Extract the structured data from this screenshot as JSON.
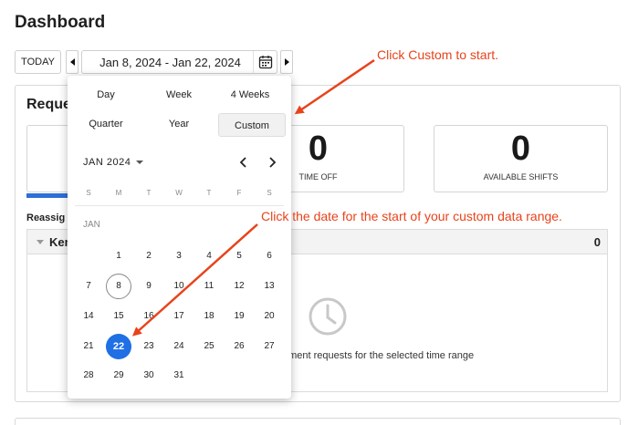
{
  "header": {
    "title": "Dashboard"
  },
  "toolbar": {
    "today_label": "TODAY",
    "date_range": "Jan 8, 2024 - Jan 22, 2024"
  },
  "requests": {
    "title": "Reque",
    "stats": [
      {
        "value": "",
        "label": ""
      },
      {
        "value": "0",
        "label": "TIME OFF"
      },
      {
        "value": "0",
        "label": "AVAILABLE SHIFTS"
      }
    ],
    "reassign_label": "Reassig",
    "group": {
      "name": "Ker",
      "count": "0"
    },
    "empty_text": "nment requests for the selected time range"
  },
  "picker": {
    "presets": [
      "Day",
      "Week",
      "4 Weeks",
      "Quarter",
      "Year",
      "Custom"
    ],
    "month_label": "JAN 2024",
    "weekdays": [
      "S",
      "M",
      "T",
      "W",
      "T",
      "F",
      "S"
    ],
    "month_sub": "JAN",
    "days": [
      "1",
      "2",
      "3",
      "4",
      "5",
      "6",
      "7",
      "8",
      "9",
      "10",
      "11",
      "12",
      "13",
      "14",
      "15",
      "16",
      "17",
      "18",
      "19",
      "20",
      "21",
      "22",
      "23",
      "24",
      "25",
      "26",
      "27",
      "28",
      "29",
      "30",
      "31"
    ],
    "today_day": "8",
    "selected_day": "22"
  },
  "annotations": {
    "custom_hint": "Click Custom to start.",
    "date_hint": "Click the date for the start of your custom data range.",
    "color": "#e8431b"
  },
  "colors": {
    "accent": "#1f6fe5"
  }
}
